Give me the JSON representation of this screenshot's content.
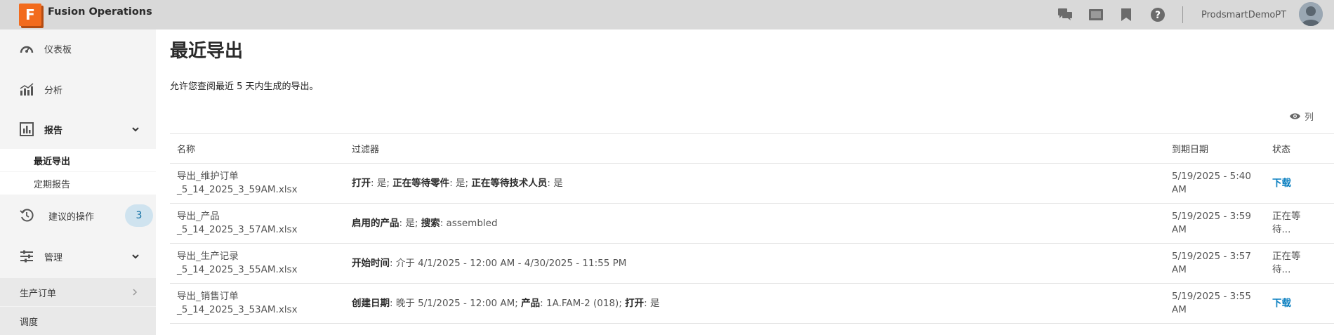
{
  "header": {
    "logo_letter": "F",
    "app_title": "Fusion Operations",
    "user_name": "ProdsmartDemoPT",
    "icons": [
      "chat-icon",
      "card-icon",
      "bookmark-icon",
      "help-icon"
    ]
  },
  "sidebar": {
    "items": [
      {
        "label": "仪表板",
        "icon": "gauge-icon"
      },
      {
        "label": "分析",
        "icon": "analytics-icon"
      },
      {
        "label": "报告",
        "icon": "report-icon"
      },
      {
        "label": "建议的操作",
        "icon": "history-icon",
        "badge": "3"
      },
      {
        "label": "管理",
        "icon": "sliders-icon"
      }
    ],
    "report_sub": [
      {
        "label": "最近导出",
        "active": true
      },
      {
        "label": "定期报告",
        "active": false
      }
    ],
    "manage_sub": [
      {
        "label": "生产订单"
      },
      {
        "label": "调度"
      }
    ]
  },
  "main": {
    "title": "最近导出",
    "description": "允许您查阅最近 5 天内生成的导出。",
    "columns_button": "列",
    "table": {
      "headers": [
        "名称",
        "过滤器",
        "到期日期",
        "状态"
      ],
      "rows": [
        {
          "name_line1": "导出_维护订单",
          "name_line2": "_5_14_2025_3_59AM.xlsx",
          "filters": [
            {
              "key": "打开",
              "value": ": 是; "
            },
            {
              "key": "正在等待零件",
              "value": ": 是; "
            },
            {
              "key": "正在等待技术人员",
              "value": ": 是"
            }
          ],
          "due_line1": "5/19/2025 - 5:40",
          "due_line2": "AM",
          "status": "下载",
          "status_is_link": true
        },
        {
          "name_line1": "导出_产品",
          "name_line2": "_5_14_2025_3_57AM.xlsx",
          "filters": [
            {
              "key": "启用的产品",
              "value": ": 是; "
            },
            {
              "key": "搜索",
              "value": ": assembled"
            }
          ],
          "due_line1": "5/19/2025 - 3:59",
          "due_line2": "AM",
          "status": "正在等待...",
          "status_is_link": false
        },
        {
          "name_line1": "导出_生产记录",
          "name_line2": "_5_14_2025_3_55AM.xlsx",
          "filters": [
            {
              "key": "开始时间",
              "value": ": 介于 4/1/2025 - 12:00 AM - 4/30/2025 - 11:55 PM"
            }
          ],
          "due_line1": "5/19/2025 - 3:57",
          "due_line2": "AM",
          "status": "正在等待...",
          "status_is_link": false
        },
        {
          "name_line1": "导出_销售订单",
          "name_line2": "_5_14_2025_3_53AM.xlsx",
          "filters": [
            {
              "key": "创建日期",
              "value": ": 晚于 5/1/2025 - 12:00 AM; "
            },
            {
              "key": "产品",
              "value": ": 1A.FAM-2 (018); "
            },
            {
              "key": "打开",
              "value": ": 是"
            }
          ],
          "due_line1": "5/19/2025 - 3:55",
          "due_line2": "AM",
          "status": "下载",
          "status_is_link": true
        }
      ]
    }
  }
}
